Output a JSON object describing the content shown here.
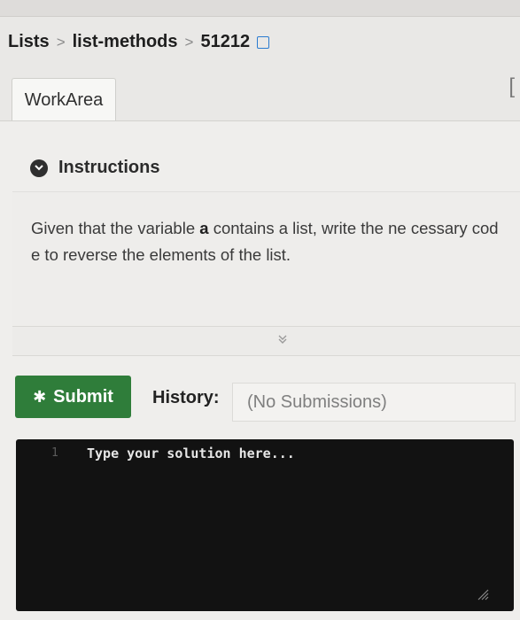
{
  "breadcrumb": {
    "items": [
      "Lists",
      "list-methods",
      "51212"
    ],
    "separator": ">"
  },
  "tabs": [
    {
      "label": "WorkArea",
      "active": true
    }
  ],
  "instructions": {
    "title": "Instructions",
    "text_before": "Given that the variable",
    "code_var": "a",
    "text_after": "contains a list, write the ne cessary code to reverse the elements of the list."
  },
  "expander_icon": "double-chevron-down-icon",
  "actions": {
    "submit_label": "Submit",
    "history_label": "History:",
    "history_value": "(No Submissions)"
  },
  "editor": {
    "line_number": "1",
    "placeholder": "Type your solution here..."
  },
  "colors": {
    "submit": "#2f7d3a",
    "editor_bg": "#121212",
    "link": "#2a7bd0"
  }
}
